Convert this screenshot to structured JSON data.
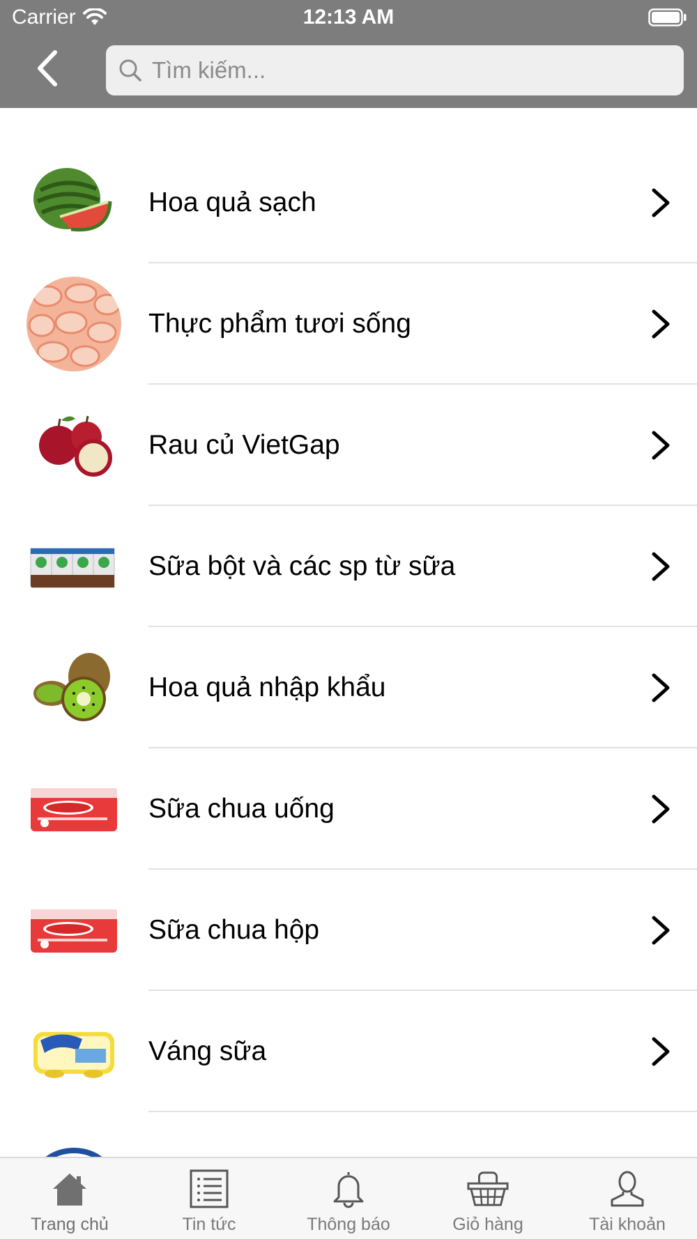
{
  "status_bar": {
    "carrier": "Carrier",
    "time": "12:13 AM"
  },
  "header": {
    "back_icon": "chevron-left-icon",
    "search": {
      "placeholder": "Tìm kiếm...",
      "value": ""
    },
    "background_color": "#7d7d7d"
  },
  "categories": [
    {
      "label": "Hoa quả sạch",
      "thumbnail": "watermelon"
    },
    {
      "label": "Thực phẩm tươi sống",
      "thumbnail": "shrimp"
    },
    {
      "label": "Rau củ VietGap",
      "thumbnail": "apples"
    },
    {
      "label": "Sữa bột và các sp từ sữa",
      "thumbnail": "milk-cartons"
    },
    {
      "label": "Hoa quả nhập khẩu",
      "thumbnail": "kiwi"
    },
    {
      "label": "Sữa chua uống",
      "thumbnail": "betagen-bottles"
    },
    {
      "label": "Sữa chua hộp",
      "thumbnail": "betagen-bottles"
    },
    {
      "label": "Váng sữa",
      "thumbnail": "monte-pudding"
    },
    {
      "label": "",
      "thumbnail": "la-vache-qui-rit"
    }
  ],
  "tab_bar": {
    "tabs": [
      {
        "label": "Trang chủ",
        "icon": "home-icon",
        "active": true
      },
      {
        "label": "Tin tức",
        "icon": "news-list-icon",
        "active": false
      },
      {
        "label": "Thông báo",
        "icon": "bell-icon",
        "active": false
      },
      {
        "label": "Giỏ hàng",
        "icon": "basket-icon",
        "active": false
      },
      {
        "label": "Tài khoản",
        "icon": "user-icon",
        "active": false
      }
    ]
  }
}
